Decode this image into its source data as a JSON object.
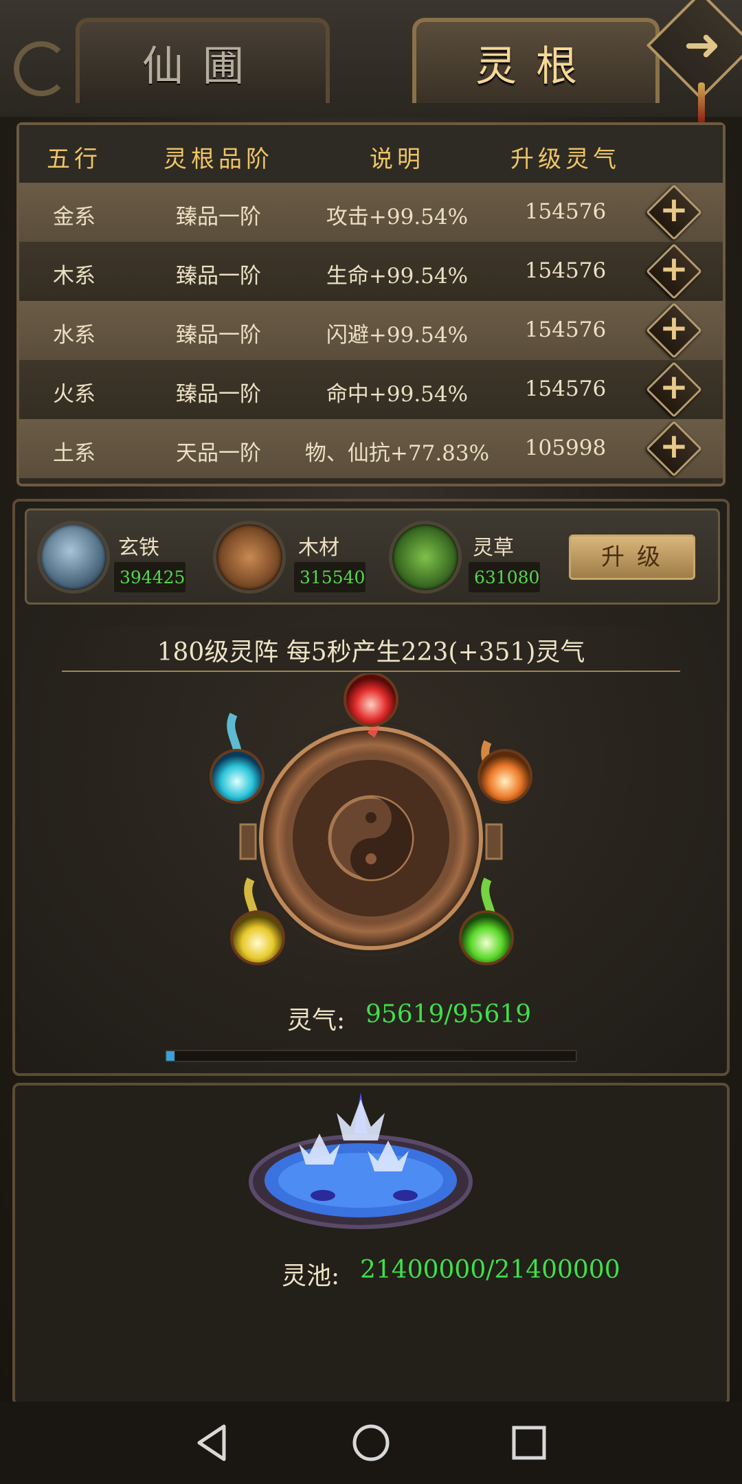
{
  "tabs": [
    {
      "label": "仙圃",
      "active": false
    },
    {
      "label": "灵根",
      "active": true
    }
  ],
  "table": {
    "headers": [
      "五行",
      "灵根品阶",
      "说明",
      "升级灵气"
    ],
    "rows": [
      {
        "element": "金系",
        "grade": "臻品一阶",
        "desc": "攻击+99.54%",
        "cost": "154576"
      },
      {
        "element": "木系",
        "grade": "臻品一阶",
        "desc": "生命+99.54%",
        "cost": "154576"
      },
      {
        "element": "水系",
        "grade": "臻品一阶",
        "desc": "闪避+99.54%",
        "cost": "154576"
      },
      {
        "element": "火系",
        "grade": "臻品一阶",
        "desc": "命中+99.54%",
        "cost": "154576"
      },
      {
        "element": "土系",
        "grade": "天品一阶",
        "desc": "物、仙抗+77.83%",
        "cost": "105998"
      }
    ]
  },
  "resources": [
    {
      "name": "玄铁",
      "value": "394425",
      "icon": "iron-icon"
    },
    {
      "name": "木材",
      "value": "315540",
      "icon": "wood-icon"
    },
    {
      "name": "灵草",
      "value": "631080",
      "icon": "herb-icon"
    }
  ],
  "upgrade_label": "升级",
  "array_text": "180级灵阵  每5秒产生223(+351)灵气",
  "qi": {
    "label": "灵气:",
    "value": "95619/95619",
    "bar_fraction": 0.02
  },
  "pool": {
    "label": "灵池:",
    "value": "21400000/21400000"
  },
  "colors": {
    "accent_gold": "#f0c565",
    "value_green": "#3fe04a",
    "bar_blue": "#3aa0d8"
  }
}
